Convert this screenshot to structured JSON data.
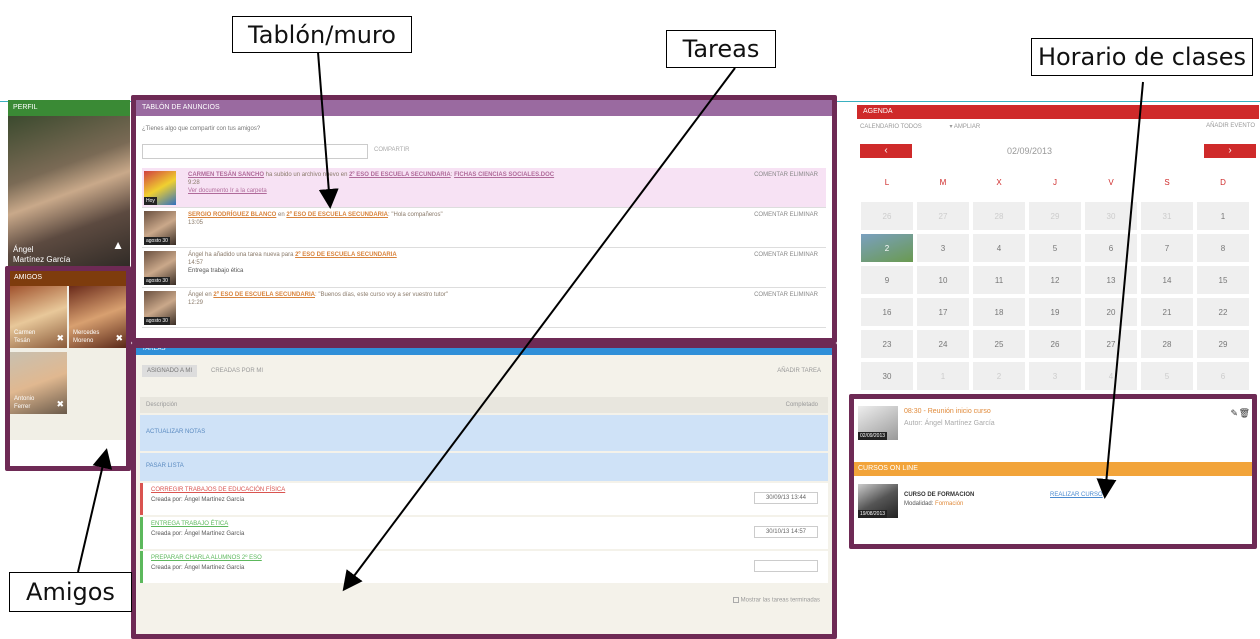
{
  "callouts": {
    "tablon": "Tablón/muro",
    "tareas": "Tareas",
    "horario": "Horario de clases",
    "amigos": "Amigos"
  },
  "perfil": {
    "header": "PERFIL",
    "name_line1": "Ángel",
    "name_line2": "Martínez García"
  },
  "amigos": {
    "header": "AMIGOS",
    "friends": [
      {
        "name1": "Carmen",
        "name2": "Tesán"
      },
      {
        "name1": "Mercedes",
        "name2": "Moreno"
      },
      {
        "name1": "Antonio",
        "name2": "Ferrer"
      }
    ]
  },
  "tablon": {
    "header": "TABLÓN DE ANUNCIOS",
    "prompt": "¿Tienes algo que compartir con tus amigos?",
    "share_button": "COMPARTIR",
    "actions": {
      "comment": "COMENTAR",
      "delete": "ELIMINAR"
    },
    "posts": [
      {
        "thumb": "Hoy",
        "user": "CARMEN TESÁN SANCHO",
        "text1": " ha subido un archivo nuevo en ",
        "target": "2º ESO DE ESCUELA SECUNDARIA",
        "text2": ": ",
        "extra": "FICHAS CIENCIAS SOCIALES.DOC",
        "time": "9:28",
        "line3": "Ver documento  Ir a la carpeta"
      },
      {
        "thumb": "agosto 30",
        "user": "SERGIO RODRÍGUEZ BLANCO",
        "text1": " en ",
        "target": "2º ESO DE ESCUELA SECUNDARIA",
        "text2": ": \"Hola compañeros\"",
        "extra": "",
        "time": "13:05",
        "line3": ""
      },
      {
        "thumb": "agosto 30",
        "user": "",
        "text1": "Ángel ha añadido una tarea nueva para ",
        "target": "2º ESO DE ESCUELA SECUNDARIA",
        "text2": "",
        "extra": "",
        "time": "14:57",
        "line3": "Entrega trabajo ética"
      },
      {
        "thumb": "agosto 30",
        "user": "",
        "text1": "Ángel en ",
        "target": "2º ESO DE ESCUELA SECUNDARIA",
        "text2": ": \"Buenos días, este curso voy a ser vuestro tutor\"",
        "extra": "",
        "time": "12:29",
        "line3": ""
      }
    ]
  },
  "tareas": {
    "header": "TAREAS",
    "tab_assigned": "ASIGNADO A MI",
    "tab_created": "CREADAS POR MI",
    "add_button": "AÑADIR TAREA",
    "col_desc": "Descripción",
    "col_done": "Completado",
    "group1": "ACTUALIZAR NOTAS",
    "group2": "PASAR LISTA",
    "tasks": [
      {
        "title": "CORREGIR TRABAJOS DE EDUCACIÓN FÍSICA",
        "by": "Creada por: Ángel Martínez García",
        "date": "30/09/13 13:44",
        "color": "#d9534f"
      },
      {
        "title": "ENTREGA TRABAJO ÉTICA",
        "by": "Creada por: Ángel Martínez García",
        "date": "30/10/13 14:57",
        "color": "#5cb85c"
      },
      {
        "title": "PREPARAR CHARLA ALUMNOS 2º ESO",
        "by": "Creada por: Ángel Martínez García",
        "date": "",
        "color": "#5cb85c"
      }
    ],
    "show_finished": "Mostrar las tareas terminadas"
  },
  "agenda": {
    "header": "AGENDA",
    "calendar_label": "CALENDARIO",
    "filter": "TODOS",
    "expand": "AMPLIAR",
    "add_event": "AÑADIR EVENTO",
    "date": "02/09/2013",
    "prev": "‹",
    "next": "›",
    "weekdays": [
      "L",
      "M",
      "X",
      "J",
      "V",
      "S",
      "D"
    ],
    "days": [
      "26",
      "27",
      "28",
      "29",
      "30",
      "31",
      "1",
      "2",
      "3",
      "4",
      "5",
      "6",
      "7",
      "8",
      "9",
      "10",
      "11",
      "12",
      "13",
      "14",
      "15",
      "16",
      "17",
      "18",
      "19",
      "20",
      "21",
      "22",
      "23",
      "24",
      "25",
      "26",
      "27",
      "28",
      "29",
      "30",
      "1",
      "2",
      "3",
      "4",
      "5",
      "6"
    ]
  },
  "horario": {
    "event_time": "08:30 - Reunión inicio curso",
    "event_author": "Autor: Ángel Martínez García",
    "event_date": "02/09/2013",
    "courses_header": "CURSOS ON LINE",
    "course_title": "CURSO DE FORMACION",
    "course_mode_label": "Modalidad:",
    "course_mode": "Formación",
    "course_action": "REALIZAR CURSO",
    "course_date": "19/08/2013"
  },
  "colors": {
    "frame": "#6e2a55",
    "agenda": "#cf2a2a",
    "tareas": "#2f8fd8",
    "tablon": "#9a6aa0"
  }
}
